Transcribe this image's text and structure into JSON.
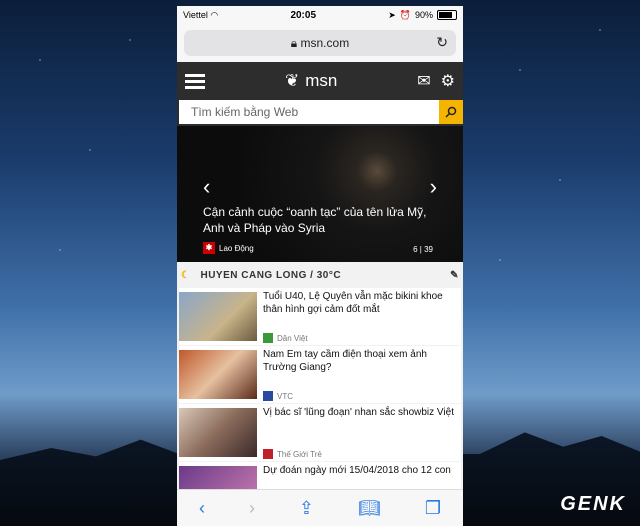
{
  "status": {
    "carrier": "Viettel",
    "time": "20:05",
    "battery": "90%"
  },
  "browser": {
    "url": "msn.com"
  },
  "header": {
    "logo_text": "msn"
  },
  "search": {
    "placeholder": "Tìm kiếm bằng Web"
  },
  "hero": {
    "headline": "Cận cảnh cuộc “oanh tạc” của tên lửa Mỹ, Anh và Pháp vào Syria",
    "source": "Lao Động",
    "counter": "6 | 39"
  },
  "weather": {
    "label": "HUYEN CANG LONG / 30°C"
  },
  "news": [
    {
      "title": "Tuổi U40, Lệ Quyên vẫn mặc bikini khoe thân hình gợi cảm đốt mắt",
      "source": "Dân Việt"
    },
    {
      "title": "Nam Em tay cầm điện thoại xem ảnh Trường Giang?",
      "source": "VTC"
    },
    {
      "title": "Vị bác sĩ 'lũng đoạn' nhan sắc showbiz Việt",
      "source": "Thế Giới Trẻ"
    },
    {
      "title": "Dự đoán ngày mới 15/04/2018 cho 12 con",
      "source": ""
    }
  ],
  "watermark": "GENK"
}
